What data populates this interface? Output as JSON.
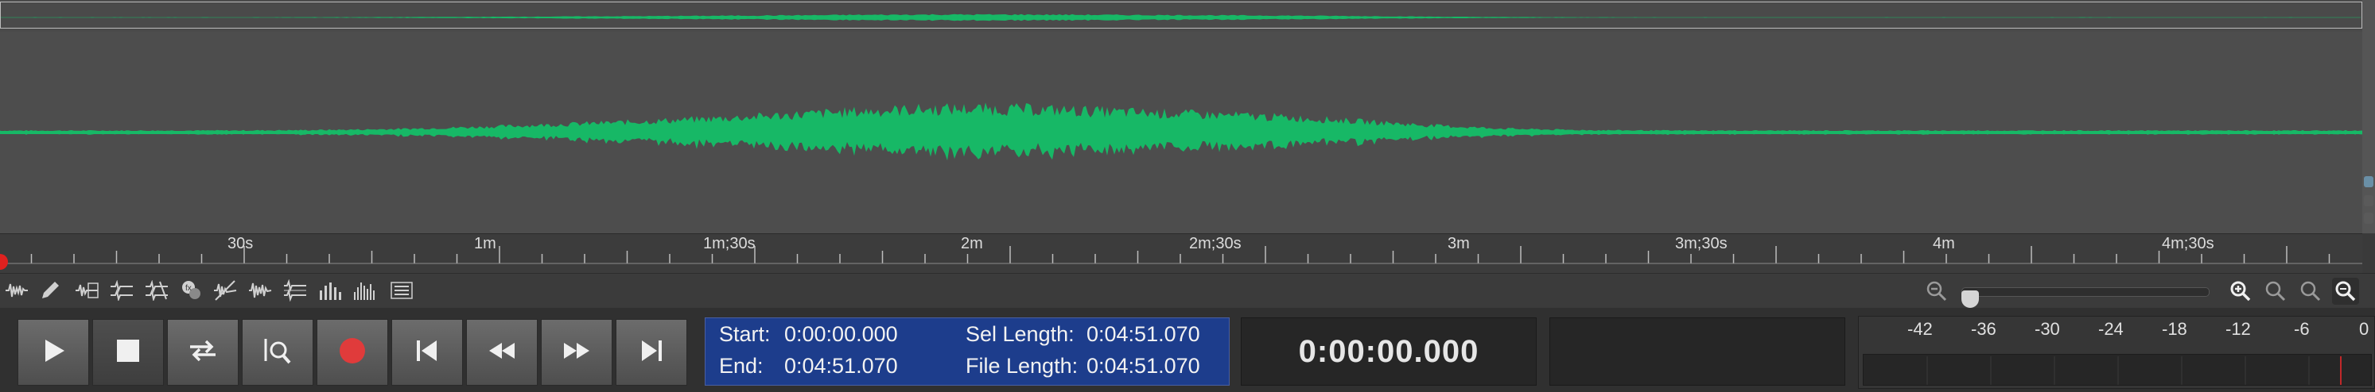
{
  "colors": {
    "waveform": "#17b866",
    "selection_panel": "#1d3d8c",
    "record": "#e03b3b",
    "playhead": "#e0211f"
  },
  "ruler": {
    "labels": [
      "30s",
      "1m",
      "1m;30s",
      "2m",
      "2m;30s",
      "3m",
      "3m;30s",
      "4m",
      "4m;30s"
    ]
  },
  "tools": [
    {
      "icon": "waveform-tool-icon"
    },
    {
      "icon": "pencil-icon"
    },
    {
      "icon": "spectral-view-icon"
    },
    {
      "icon": "multi-view-icon"
    },
    {
      "icon": "level-view-icon"
    },
    {
      "icon": "effects-icon"
    },
    {
      "icon": "noise-icon"
    },
    {
      "icon": "wave-edit-icon"
    },
    {
      "icon": "stereo-icon"
    },
    {
      "icon": "bars-icon"
    },
    {
      "icon": "spectrum-icon"
    },
    {
      "icon": "list-icon"
    }
  ],
  "zoom": {
    "level_fraction": 0.0
  },
  "transport": {
    "buttons": [
      "play-icon",
      "stop-icon",
      "loop-icon",
      "scrub-icon",
      "record-icon",
      "skip-start-icon",
      "rewind-icon",
      "fast-forward-icon",
      "skip-end-icon"
    ]
  },
  "selection": {
    "start_label": "Start:",
    "start_value": "0:00:00.000",
    "end_label": "End:",
    "end_value": "0:04:51.070",
    "sel_length_label": "Sel Length:",
    "sel_length_value": "0:04:51.070",
    "file_length_label": "File Length:",
    "file_length_value": "0:04:51.070"
  },
  "time_display": "0:00:00.000",
  "meter": {
    "labels": [
      "-42",
      "-36",
      "-30",
      "-24",
      "-18",
      "-12",
      "-6",
      "0"
    ]
  }
}
